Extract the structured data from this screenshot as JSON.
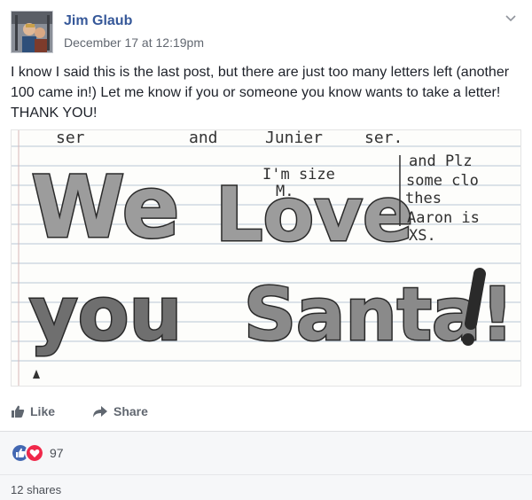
{
  "post": {
    "author": "Jim Glaub",
    "timestamp": "December 17 at 12:19pm",
    "text": "I know I said this is the last post, but there are just too many letters left (another 100 came in!) Let me know if you or someone you know wants to take a letter! THANK YOU!"
  },
  "letter_image": {
    "top_partial": [
      "ser",
      "and",
      "Junier",
      "ser."
    ],
    "main_line_1": [
      "We",
      "Love"
    ],
    "main_line_2": [
      "you",
      "Santa!"
    ],
    "note_left": [
      "I'm size",
      "M."
    ],
    "note_right": [
      "and Plz",
      "some clo",
      "thes",
      "Aaron is",
      "XS."
    ]
  },
  "actions": {
    "like_label": "Like",
    "share_label": "Share"
  },
  "reactions": {
    "count": "97"
  },
  "shares": {
    "label": "12 shares"
  },
  "colors": {
    "author": "#365899",
    "like_blue": "#4267b2",
    "love_red": "#f0284a"
  }
}
